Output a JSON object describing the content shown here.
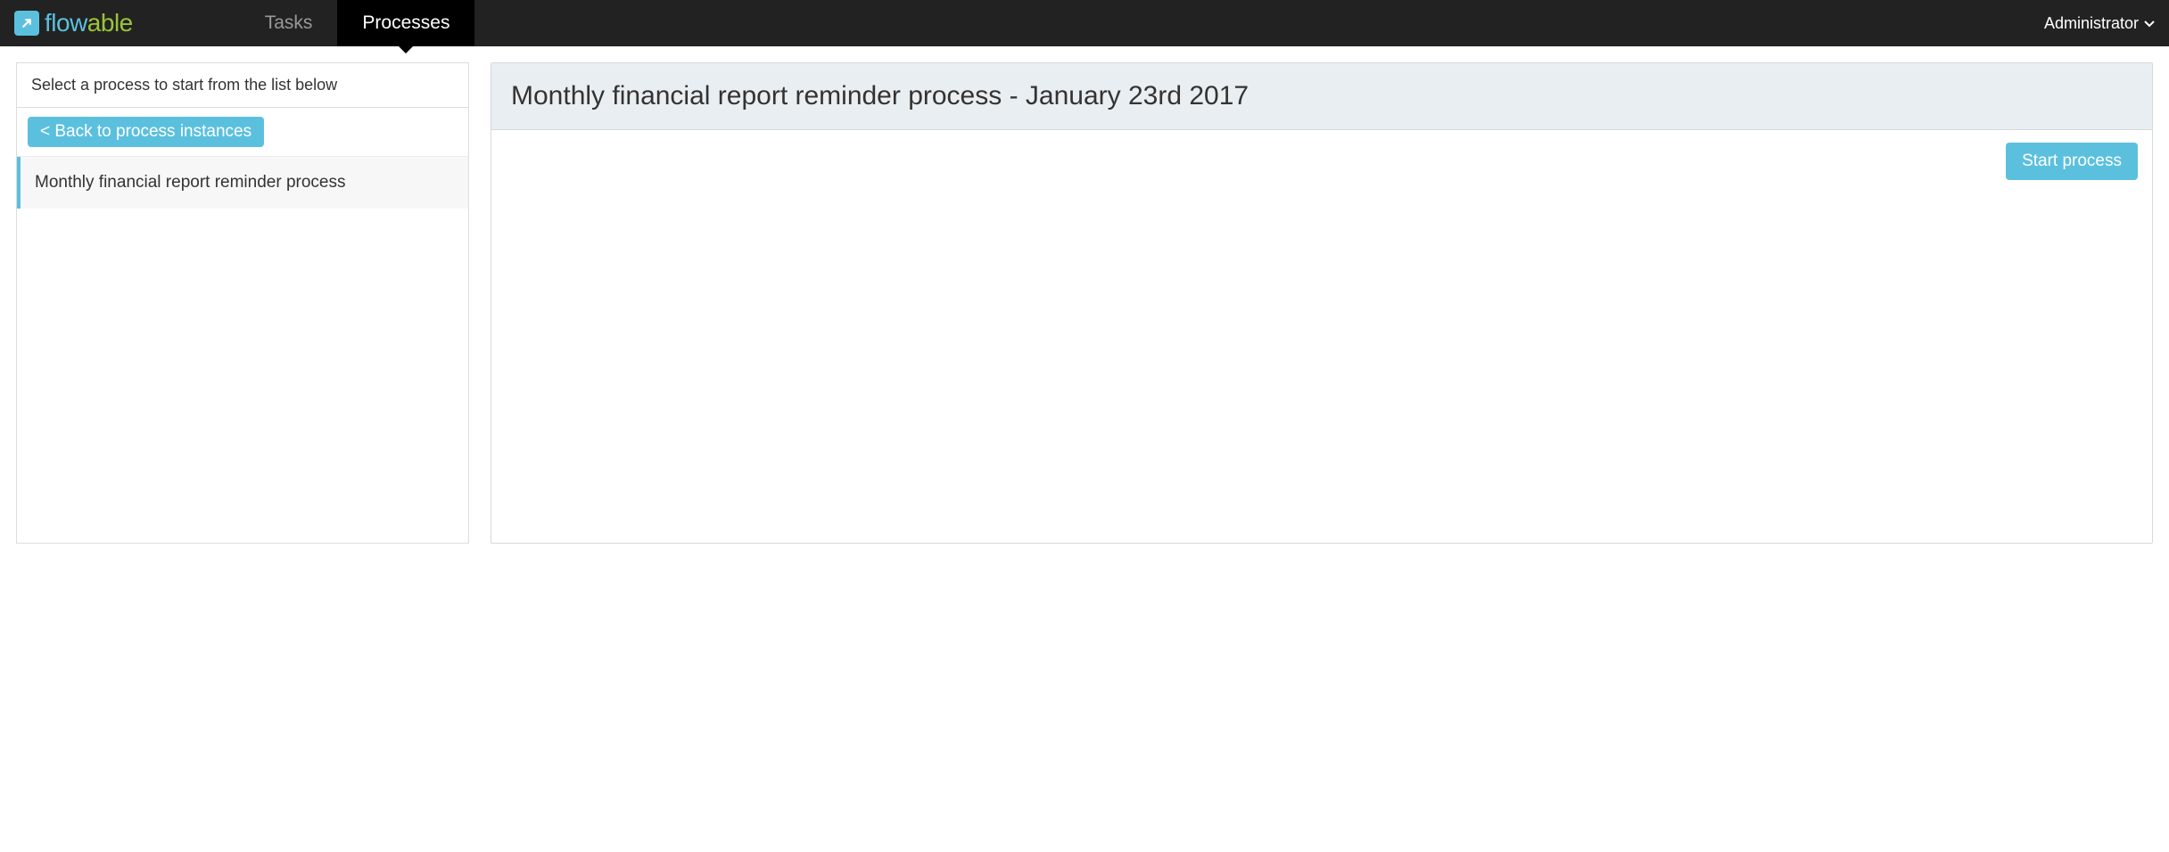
{
  "navbar": {
    "logo_flow": "flow",
    "logo_able": "able",
    "tabs": [
      {
        "label": "Tasks",
        "active": false
      },
      {
        "label": "Processes",
        "active": true
      }
    ],
    "user_label": "Administrator"
  },
  "sidebar": {
    "header": "Select a process to start from the list below",
    "back_label": "< Back to process instances",
    "items": [
      {
        "label": "Monthly financial report reminder process",
        "selected": true
      }
    ]
  },
  "content": {
    "title": "Monthly financial report reminder process - January 23rd 2017",
    "start_label": "Start process"
  }
}
